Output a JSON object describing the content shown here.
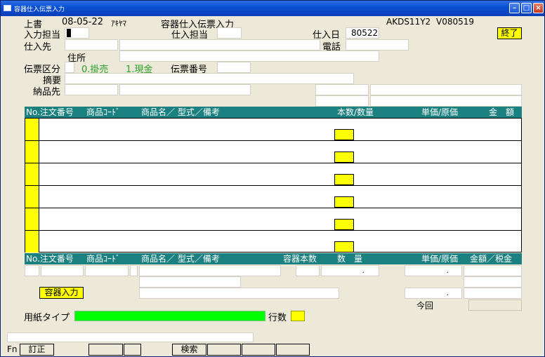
{
  "window": {
    "title": "容器仕入伝票入力"
  },
  "header": {
    "mode": "上書",
    "date": "08-05-22",
    "user": "ｱｷﾔﾏ",
    "screen_title": "容器仕入伝票入力",
    "program_id": "AKDS11Y2",
    "version": "V080519",
    "exit_label": "終了"
  },
  "form": {
    "input_staff_label": "入力担当",
    "purchase_staff_label": "仕入担当",
    "purchase_date_label": "仕入日",
    "purchase_date_value": "80522",
    "supplier_label": "仕入先",
    "phone_label": "電話",
    "address_label": "住所",
    "slip_type_label": "伝票区分",
    "slip_type_opt0": "0.掛売",
    "slip_type_opt1": "1.現金",
    "slip_number_label": "伝票番号",
    "summary_label": "摘要",
    "delivery_label": "納品先"
  },
  "grid": {
    "headers": {
      "no_order": "No.注文番号",
      "product_code": "商品ｺｰﾄﾞ",
      "product_name": "商品名／ 型式／備考",
      "qty": "本数/数量",
      "price": "単価/原価",
      "amount": "金　額"
    },
    "rows": 6
  },
  "detail": {
    "headers": {
      "no_order": "No.注文番号",
      "product_code": "商品ｺｰﾄﾞ",
      "product_name": "商品名／ 型式／備考",
      "container_count": "容器本数",
      "quantity": "数　量",
      "price": "単価/原価",
      "amount_tax": "金額／税金"
    },
    "qty_dot": ".",
    "price_dot": ".",
    "price2_dot": ".",
    "container_input_label": "容器入力",
    "this_time_label": "今回"
  },
  "paper": {
    "type_label": "用紙タイプ",
    "lines_label": "行数"
  },
  "fkeys": {
    "fn_label": "Fn",
    "f1": "訂正",
    "f5": "検索"
  },
  "colors": {
    "header_teal": "#1a8080",
    "highlight_yellow": "#ffff00",
    "progress_green": "#00ff00",
    "label_green": "#2aa02a"
  }
}
